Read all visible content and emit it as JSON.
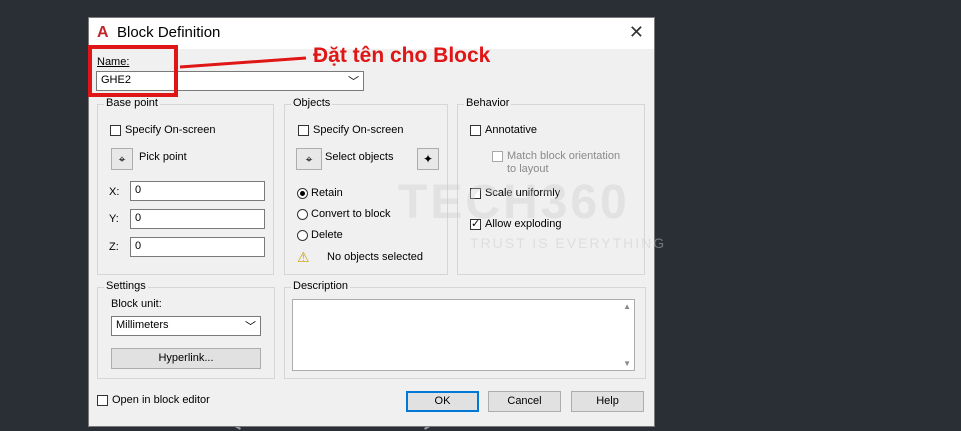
{
  "window": {
    "title": "Block Definition"
  },
  "name_section": {
    "label": "Name:",
    "value": "GHE2"
  },
  "base_point": {
    "title": "Base point",
    "specify_onscreen": "Specify On-screen",
    "pick_point": "Pick point",
    "x_label": "X:",
    "x_value": "0",
    "y_label": "Y:",
    "y_value": "0",
    "z_label": "Z:",
    "z_value": "0"
  },
  "objects": {
    "title": "Objects",
    "specify_onscreen": "Specify On-screen",
    "select_objects": "Select objects",
    "retain": "Retain",
    "convert": "Convert to block",
    "delete": "Delete",
    "status": "No objects selected"
  },
  "behavior": {
    "title": "Behavior",
    "annotative": "Annotative",
    "match_line1": "Match block orientation",
    "match_line2": "to layout",
    "scale_uniformly": "Scale uniformly",
    "allow_exploding": "Allow exploding"
  },
  "settings": {
    "title": "Settings",
    "block_unit_label": "Block unit:",
    "block_unit_value": "Millimeters",
    "hyperlink": "Hyperlink..."
  },
  "description": {
    "title": "Description"
  },
  "footer": {
    "open_in_editor": "Open in block editor",
    "ok": "OK",
    "cancel": "Cancel",
    "help": "Help"
  },
  "annotation": {
    "text": "Đặt tên cho Block"
  },
  "watermark": {
    "brand": "TECH360",
    "tagline": "TRUST IS EVERYTHING"
  },
  "colors": {
    "annotation_red": "#e01515",
    "default_button_blue": "#0078d7"
  }
}
